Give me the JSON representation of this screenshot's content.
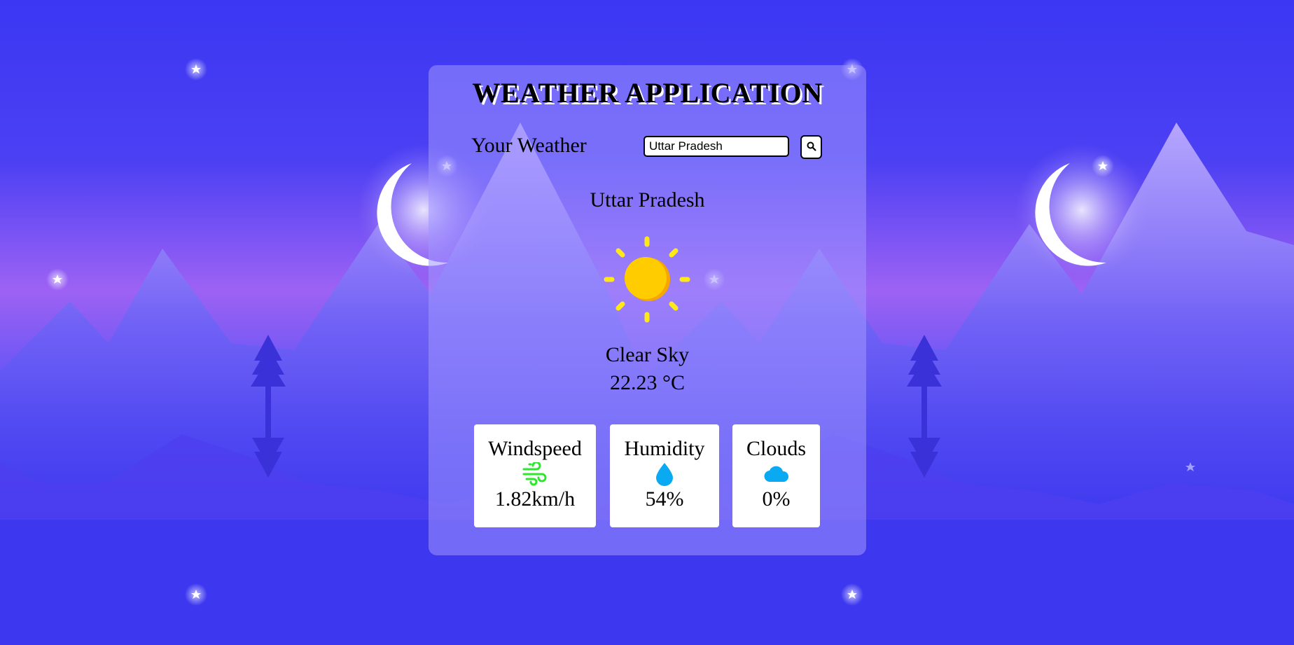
{
  "app": {
    "title": "WEATHER APPLICATION"
  },
  "search": {
    "label": "Your Weather",
    "value": "Uttar Pradesh",
    "button_icon": "search-icon"
  },
  "weather": {
    "city": "Uttar Pradesh",
    "condition_icon": "sun-icon",
    "description": "Clear Sky",
    "temperature": "22.23 °C"
  },
  "stats": [
    {
      "label": "Windspeed",
      "icon": "wind-icon",
      "value": "1.82km/h",
      "icon_color": "#2be82b"
    },
    {
      "label": "Humidity",
      "icon": "droplet-icon",
      "value": "54%",
      "icon_color": "#0aaaf2"
    },
    {
      "label": "Clouds",
      "icon": "cloud-icon",
      "value": "0%",
      "icon_color": "#0aaaf2"
    }
  ],
  "colors": {
    "background": "#3d3af2",
    "sky_glow": "#a468f5",
    "sun": "#ffcc00",
    "sun_rays": "#ffe81a"
  }
}
